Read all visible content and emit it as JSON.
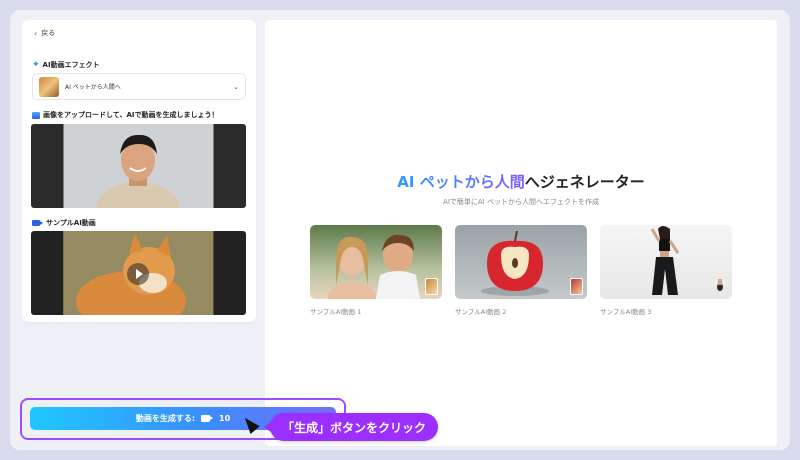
{
  "left": {
    "back_label": "戻る",
    "effect_title": "AI動画エフェクト",
    "selected_effect": "AI ペットから人間へ",
    "upload_prompt": "画像をアップロードして、AIで動画を生成しましょう！",
    "sample_title": "サンプルAI動画"
  },
  "hero": {
    "title_accent": "AI ペットから人間",
    "title_rest": "へジェネレーター",
    "subtitle": "AIで簡単にAI ペットから人間へエフェクトを作成"
  },
  "samples": [
    {
      "label": "サンプルAI動画 1"
    },
    {
      "label": "サンプルAI動画 2"
    },
    {
      "label": "サンプルAI動画 3"
    }
  ],
  "generate": {
    "label": "動画を生成する:",
    "credits": "10"
  },
  "callout": "「生成」ボタンをクリック",
  "colors": {
    "accent_blue": "#2f9bff",
    "accent_purple": "#9b2fff"
  }
}
